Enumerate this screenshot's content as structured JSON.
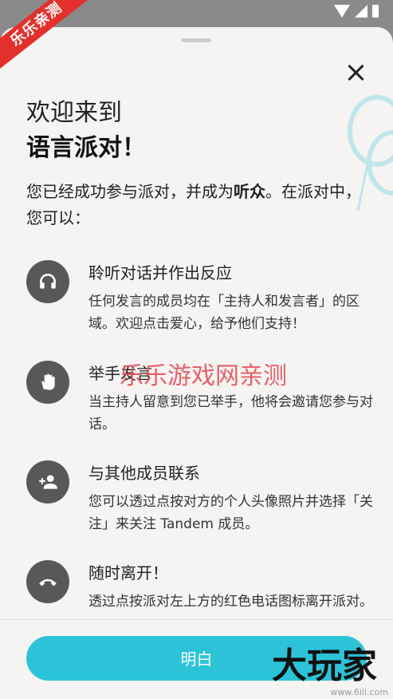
{
  "ribbon": "乐乐亲测",
  "title_line1": "欢迎来到",
  "title_line2": "语言派对！",
  "intro_pre": "您已经成功参与派对，并成为",
  "intro_bold": "听众",
  "intro_post": "。在派对中，您可以：",
  "items": [
    {
      "title": "聆听对话并作出反应",
      "desc": "任何发言的成员均在「主持人和发言者」的区域。欢迎点击爱心，给予他们支持！",
      "icon": "headphones-icon"
    },
    {
      "title": "举手发言",
      "desc": "当主持人留意到您已举手，他将会邀请您参与对话。",
      "icon": "raised-hand-icon"
    },
    {
      "title": "与其他成员联系",
      "desc": "您可以透过点按对方的个人头像照片并选择「关注」来关注 Tandem 成员。",
      "icon": "add-person-icon"
    },
    {
      "title": "随时离开！",
      "desc": "透过点按派对左上方的红色电话图标离开派对。",
      "icon": "hang-up-phone-icon"
    }
  ],
  "button_label": "明白",
  "watermark_red": "乐乐游戏网亲测",
  "watermark_big": "大玩家",
  "watermark_small": "www.6ill.com",
  "colors": {
    "accent": "#2cc3d9",
    "icon_bg": "#585858",
    "ribbon": "#e3302c"
  }
}
